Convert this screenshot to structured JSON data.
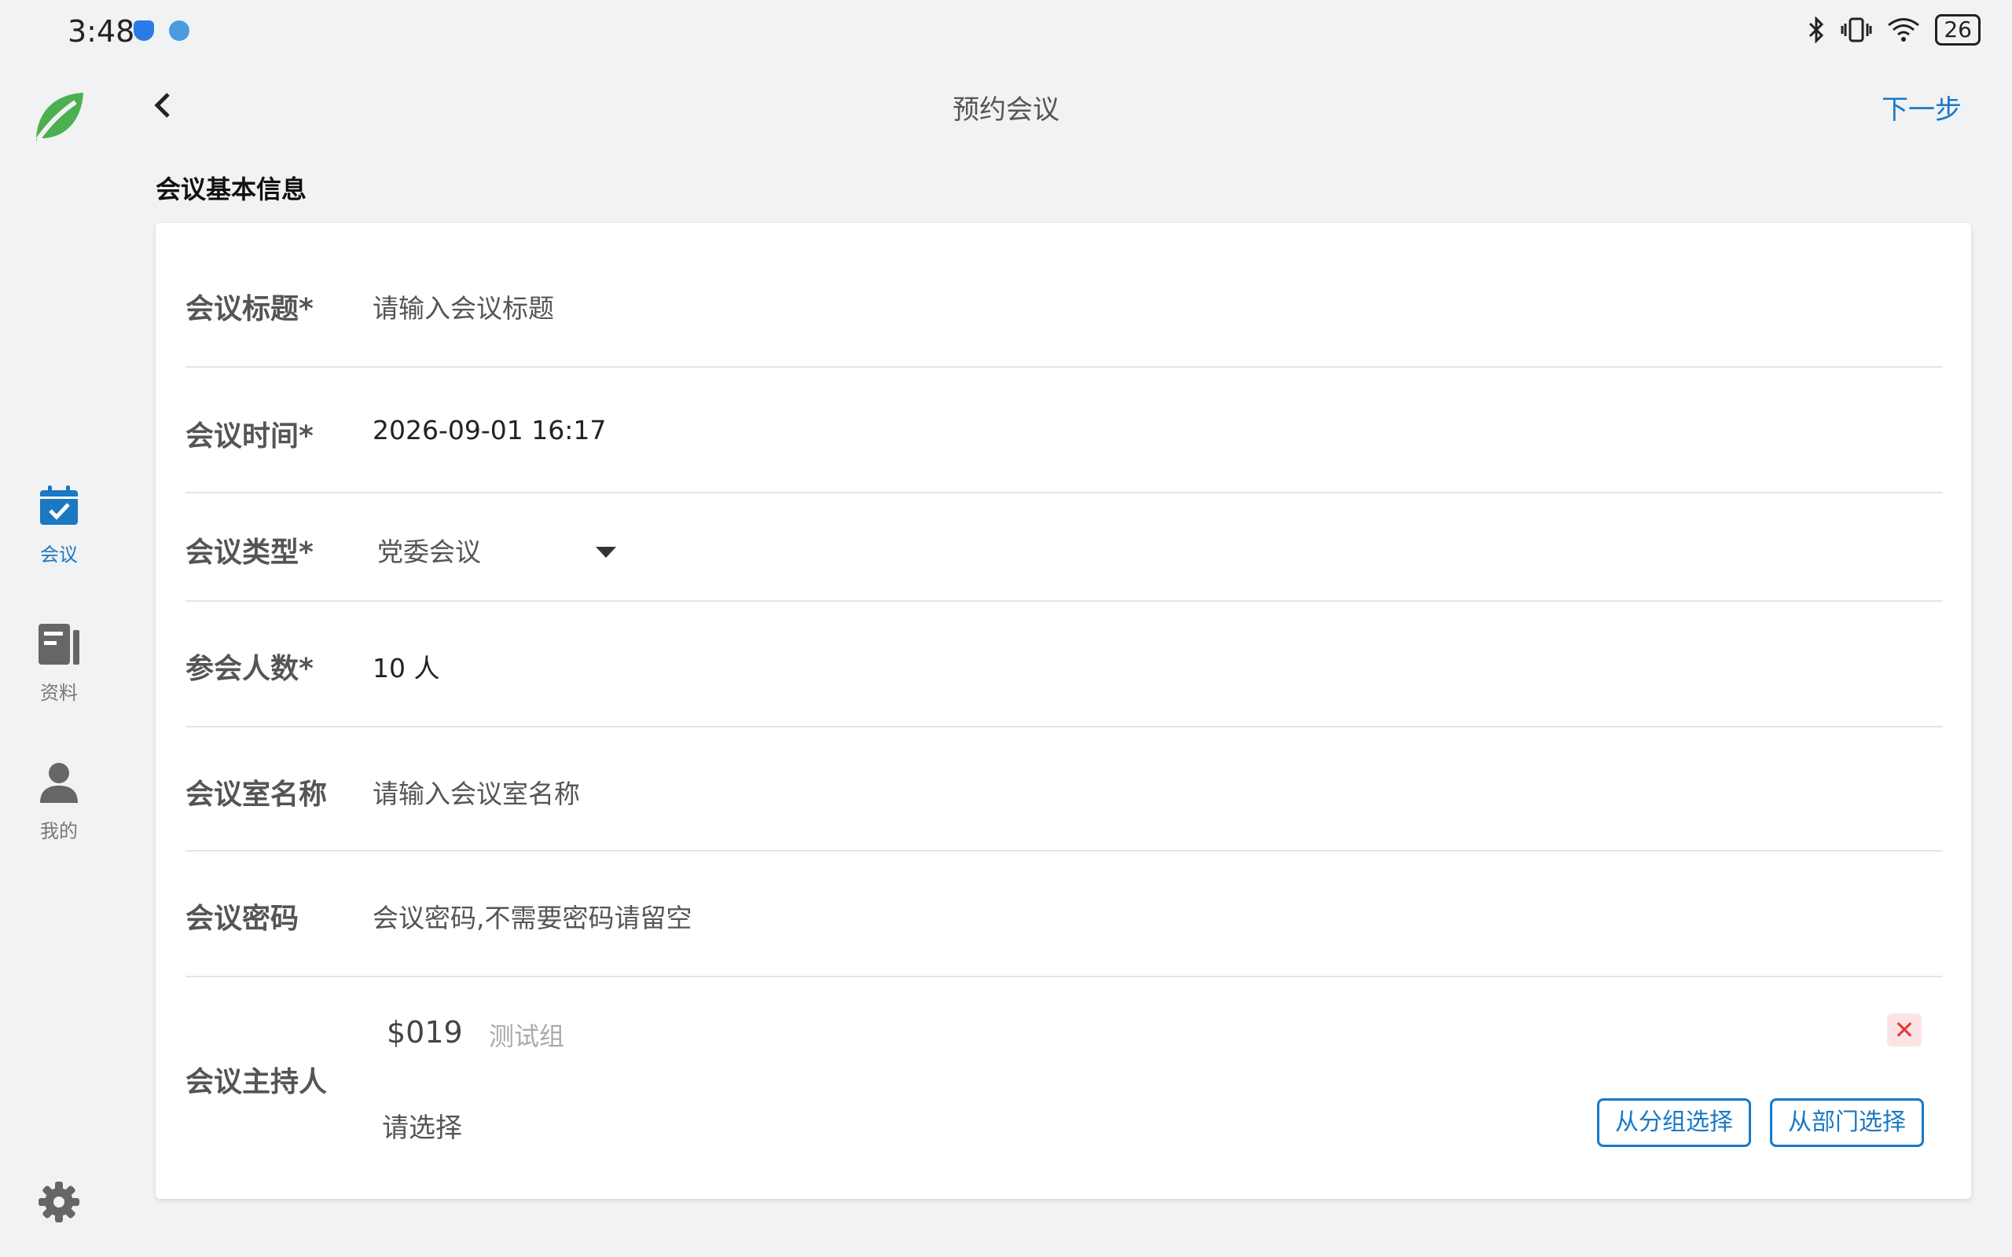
{
  "status_bar": {
    "time": "3:48",
    "battery": "26",
    "icons": [
      "shield-icon",
      "globe-icon",
      "bluetooth-icon",
      "vibrate-icon",
      "wifi-icon",
      "battery-icon"
    ]
  },
  "sidebar": {
    "items": [
      {
        "label": "会议",
        "icon": "calendar-check-icon",
        "active": true
      },
      {
        "label": "资料",
        "icon": "document-icon",
        "active": false
      },
      {
        "label": "我的",
        "icon": "person-icon",
        "active": false
      }
    ],
    "settings_icon": "gear-icon"
  },
  "header": {
    "title": "预约会议",
    "next_label": "下一步"
  },
  "section": {
    "title": "会议基本信息"
  },
  "form": {
    "title": {
      "label": "会议标题*",
      "placeholder": "请输入会议标题"
    },
    "time": {
      "label": "会议时间*",
      "value": "2026-09-01 16:17"
    },
    "type": {
      "label": "会议类型*",
      "value": "党委会议"
    },
    "attendees": {
      "label": "参会人数*",
      "value": "10 人"
    },
    "room": {
      "label": "会议室名称",
      "placeholder": "请输入会议室名称"
    },
    "password": {
      "label": "会议密码",
      "placeholder": "会议密码,不需要密码请留空"
    },
    "host": {
      "label": "会议主持人",
      "selected_id": "$019",
      "selected_group": "测试组",
      "choose_text": "请选择",
      "from_group_label": "从分组选择",
      "from_dept_label": "从部门选择"
    }
  },
  "colors": {
    "accent": "#1b78c3",
    "background": "#f1f2f4",
    "card": "#ffffff",
    "logo_green": "#4caf50",
    "remove_red": "#e23b3b"
  }
}
